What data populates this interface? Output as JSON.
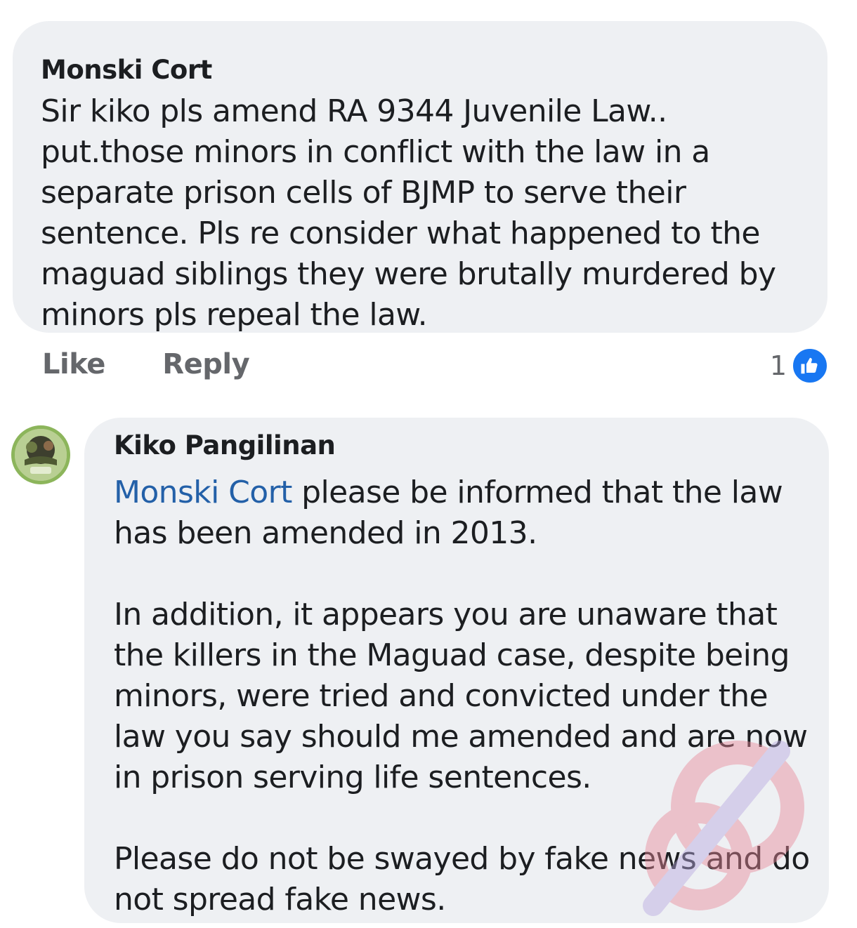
{
  "comment": {
    "author": "Monski Cort",
    "lines": [
      "Sir kiko pls amend RA 9344 Juvenile Law..",
      "put.those minors in conflict with the law in a",
      "separate prison cells of BJMP to serve their",
      "sentence. Pls re consider what happened to the",
      "maguad siblings they were brutally murdered by",
      "minors pls repeal the law."
    ],
    "actions": {
      "like": "Like",
      "reply": "Reply"
    },
    "reaction_count": "1",
    "reaction_icon": "like-icon",
    "reaction_color": "#1877f2"
  },
  "reply": {
    "author": "Kiko Pangilinan",
    "mention": "Monski Cort",
    "paragraph_1": {
      "line_1_rest": " please be informed that the law",
      "line_2": "has been amended in 2013."
    },
    "paragraph_2": [
      "In addition, it appears you are unaware that",
      "the killers in the Maguad case, despite being",
      "minors, were tried and convicted under the",
      "law you say should me amended and are now",
      "in prison serving life sentences."
    ],
    "paragraph_3": [
      "Please do not be swayed by fake news and do",
      "not spread fake news."
    ],
    "mention_color": "#2360a8"
  },
  "colors": {
    "bubble": "#eef0f3",
    "text": "#1c1e21",
    "muted": "#65676b"
  }
}
